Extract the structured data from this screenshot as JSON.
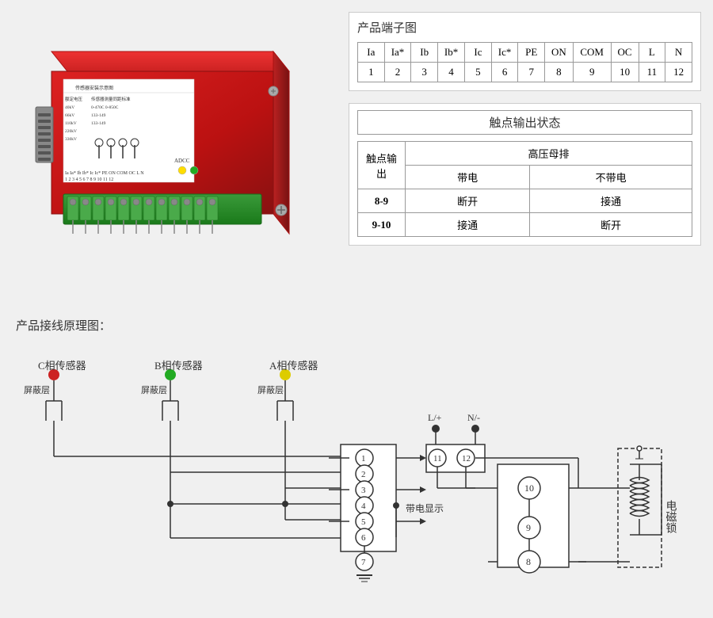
{
  "product_image_alt": "产品图片",
  "terminal_diagram": {
    "title": "产品端子图",
    "headers": [
      "Ia",
      "Ia*",
      "Ib",
      "Ib*",
      "Ic",
      "Ic*",
      "PE",
      "ON",
      "COM",
      "OC",
      "L",
      "N"
    ],
    "numbers": [
      "1",
      "2",
      "3",
      "4",
      "5",
      "6",
      "7",
      "8",
      "9",
      "10",
      "11",
      "12"
    ]
  },
  "contact_state": {
    "title": "触点输出状态",
    "col_header1": "高压母排",
    "col_header2": "带电",
    "col_header3": "不带电",
    "row_header": "触点输出",
    "rows": [
      {
        "pin": "8-9",
        "powered": "断开",
        "unpowered": "接通"
      },
      {
        "pin": "9-10",
        "powered": "接通",
        "unpowered": "断开"
      }
    ]
  },
  "wiring": {
    "title": "产品接线原理图：",
    "sensors": [
      {
        "label": "C相传感器",
        "color": "#cc2222"
      },
      {
        "label": "B相传感器",
        "color": "#22aa22"
      },
      {
        "label": "A相传感器",
        "color": "#ddcc00"
      }
    ],
    "shield_label": "屏蔽层",
    "power_plus": "L/+",
    "power_minus": "N/-",
    "powered_display": "带电显示",
    "electromagnetic_lock": "电磁锁",
    "terminals": [
      "1",
      "2",
      "3",
      "4",
      "5",
      "6",
      "7",
      "8",
      "9",
      "10",
      "11",
      "12"
    ]
  }
}
